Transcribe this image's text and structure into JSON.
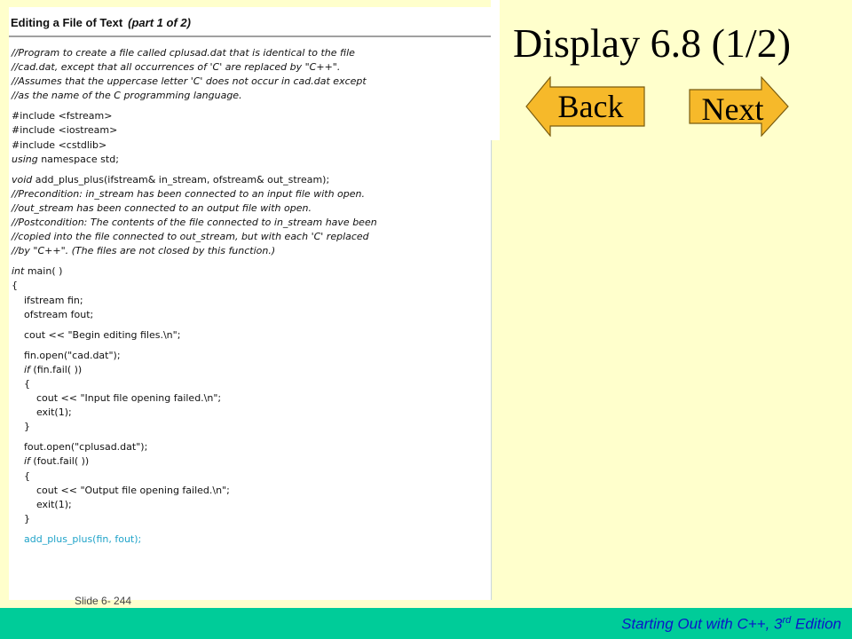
{
  "slide": {
    "title": "Display 6.8  (1/2)",
    "slide_number": "Slide 6- 244"
  },
  "panel": {
    "heading": "Editing a File of Text",
    "part_label": "(part 1 of 2)",
    "lines": [
      {
        "text": "//Program to create a file called cplusad.dat that is identical to the file",
        "style": "comment"
      },
      {
        "text": "//cad.dat, except that all occurrences of 'C' are replaced by \"C++\".",
        "style": "comment"
      },
      {
        "text": "//Assumes that the uppercase letter 'C' does not occur in cad.dat except",
        "style": "comment"
      },
      {
        "text": "//as the name of the C programming language.",
        "style": "comment"
      },
      {
        "text": "",
        "style": "blank"
      },
      {
        "text": "#include <fstream>",
        "style": "code"
      },
      {
        "text": "#include <iostream>",
        "style": "code"
      },
      {
        "text": "#include <cstdlib>",
        "style": "code"
      },
      {
        "text": "using namespace std;",
        "style": "kw-start",
        "kw": "using",
        "rest": " namespace std;"
      },
      {
        "text": "",
        "style": "blank"
      },
      {
        "text": "void add_plus_plus(ifstream& in_stream, ofstream& out_stream);",
        "style": "kw-start",
        "kw": "void",
        "rest": " add_plus_plus(ifstream& in_stream, ofstream& out_stream);"
      },
      {
        "text": "//Precondition: in_stream has been connected to an input file with open.",
        "style": "comment"
      },
      {
        "text": "//out_stream has been connected to an output file with open.",
        "style": "comment"
      },
      {
        "text": "//Postcondition: The contents of the file connected to in_stream have been",
        "style": "comment"
      },
      {
        "text": "//copied into the file connected to out_stream, but with each 'C' replaced",
        "style": "comment"
      },
      {
        "text": "//by \"C++\". (The files are not closed by this function.)",
        "style": "comment"
      },
      {
        "text": "",
        "style": "blank"
      },
      {
        "text": "int main( )",
        "style": "kw-start",
        "kw": "int",
        "rest": " main( )"
      },
      {
        "text": "{",
        "style": "code"
      },
      {
        "text": "    ifstream fin;",
        "style": "code"
      },
      {
        "text": "    ofstream fout;",
        "style": "code"
      },
      {
        "text": "",
        "style": "blank"
      },
      {
        "text": "    cout << \"Begin editing files.\\n\";",
        "style": "code"
      },
      {
        "text": "",
        "style": "blank"
      },
      {
        "text": "    fin.open(\"cad.dat\");",
        "style": "code"
      },
      {
        "text": "    if (fin.fail( ))",
        "style": "kw-start",
        "kw": "    if",
        "rest": " (fin.fail( ))"
      },
      {
        "text": "    {",
        "style": "code"
      },
      {
        "text": "        cout << \"Input file opening failed.\\n\";",
        "style": "code"
      },
      {
        "text": "        exit(1);",
        "style": "code"
      },
      {
        "text": "    }",
        "style": "code"
      },
      {
        "text": "",
        "style": "blank"
      },
      {
        "text": "    fout.open(\"cplusad.dat\");",
        "style": "code"
      },
      {
        "text": "    if (fout.fail( ))",
        "style": "kw-start",
        "kw": "    if",
        "rest": " (fout.fail( ))"
      },
      {
        "text": "    {",
        "style": "code"
      },
      {
        "text": "        cout << \"Output file opening failed.\\n\";",
        "style": "code"
      },
      {
        "text": "        exit(1);",
        "style": "code"
      },
      {
        "text": "    }",
        "style": "code"
      },
      {
        "text": "",
        "style": "blank"
      },
      {
        "text": "    add_plus_plus(fin, fout);",
        "style": "highlight"
      }
    ]
  },
  "nav": {
    "back_label": "Back",
    "next_label": "Next",
    "button_fill": "#f6b92a",
    "button_stroke": "#7a5c10"
  },
  "footer": {
    "text_main": "Starting Out with C++, 3",
    "text_sup": "rd",
    "text_end": " Edition",
    "bar_color": "#00cc99",
    "text_color": "#0b16c9"
  },
  "colors": {
    "background": "#ffffcc",
    "highlight_code": "#1fa3c9"
  }
}
